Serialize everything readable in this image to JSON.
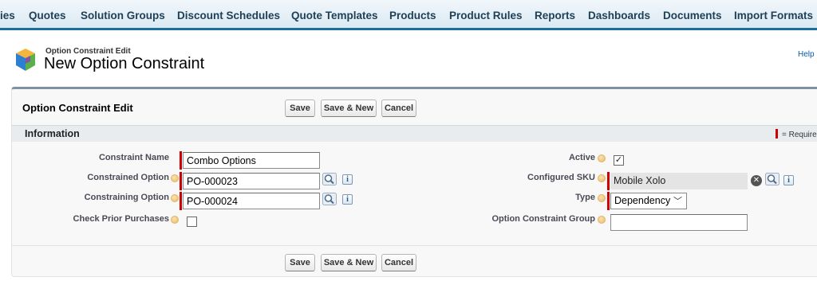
{
  "nav": {
    "tabs": [
      "ies",
      "Quotes",
      "Solution Groups",
      "Discount Schedules",
      "Quote Templates",
      "Products",
      "Product Rules",
      "Reports",
      "Dashboards",
      "Documents",
      "Import Formats"
    ]
  },
  "header": {
    "breadcrumb": "Option Constraint Edit",
    "title": "New Option Constraint",
    "help": "Help"
  },
  "edit": {
    "block_title": "Option Constraint Edit",
    "save_label": "Save",
    "save_new_label": "Save & New",
    "cancel_label": "Cancel"
  },
  "section": {
    "title": "Information",
    "required_legend": "= Required"
  },
  "fields": {
    "constraint_name": {
      "label": "Constraint Name",
      "value": "Combo Options"
    },
    "constrained_option": {
      "label": "Constrained Option",
      "value": "PO-000023"
    },
    "constraining_option": {
      "label": "Constraining Option",
      "value": "PO-000024"
    },
    "check_prior_purchases": {
      "label": "Check Prior Purchases",
      "checked": false
    },
    "active": {
      "label": "Active",
      "checked": true
    },
    "configured_sku": {
      "label": "Configured SKU",
      "value": "Mobile Xolo"
    },
    "type": {
      "label": "Type",
      "value": "Dependency"
    },
    "option_constraint_group": {
      "label": "Option Constraint Group",
      "value": ""
    }
  },
  "icons": {
    "page": "option-constraint-icon",
    "lookup": "magnifier-lookup-icon",
    "info": "info-icon",
    "help": "help-bubble-icon",
    "clear": "clear-icon",
    "dropdown": "chevron-down-icon"
  },
  "colors": {
    "tab_bar_border": "#1f6d9c",
    "required": "#cc0000",
    "link": "#015ba7"
  }
}
